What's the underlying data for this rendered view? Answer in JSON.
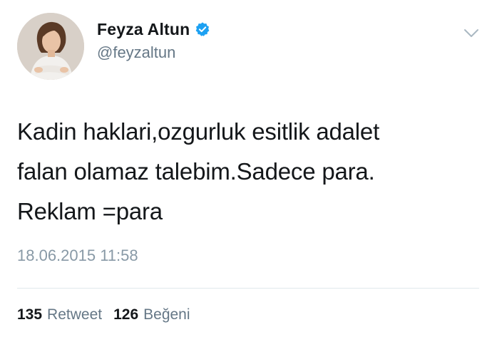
{
  "tweet": {
    "author": {
      "display_name": "Feyza Altun",
      "handle": "@feyzaltun",
      "verified": true
    },
    "body_lines": [
      "Kadin haklari,ozgurluk esitlik adalet",
      "falan olamaz talebim.Sadece para.",
      "Reklam =para"
    ],
    "timestamp": "18.06.2015 11:58",
    "stats": {
      "retweets": {
        "count": "135",
        "label": "Retweet"
      },
      "likes": {
        "count": "126",
        "label": "Beğeni"
      }
    }
  },
  "colors": {
    "verified_badge": "#1da1f2",
    "secondary_text": "#657786",
    "divider": "#e1e8ed"
  },
  "icons": {
    "verified": "verified-badge-icon",
    "menu": "chevron-down-icon"
  }
}
